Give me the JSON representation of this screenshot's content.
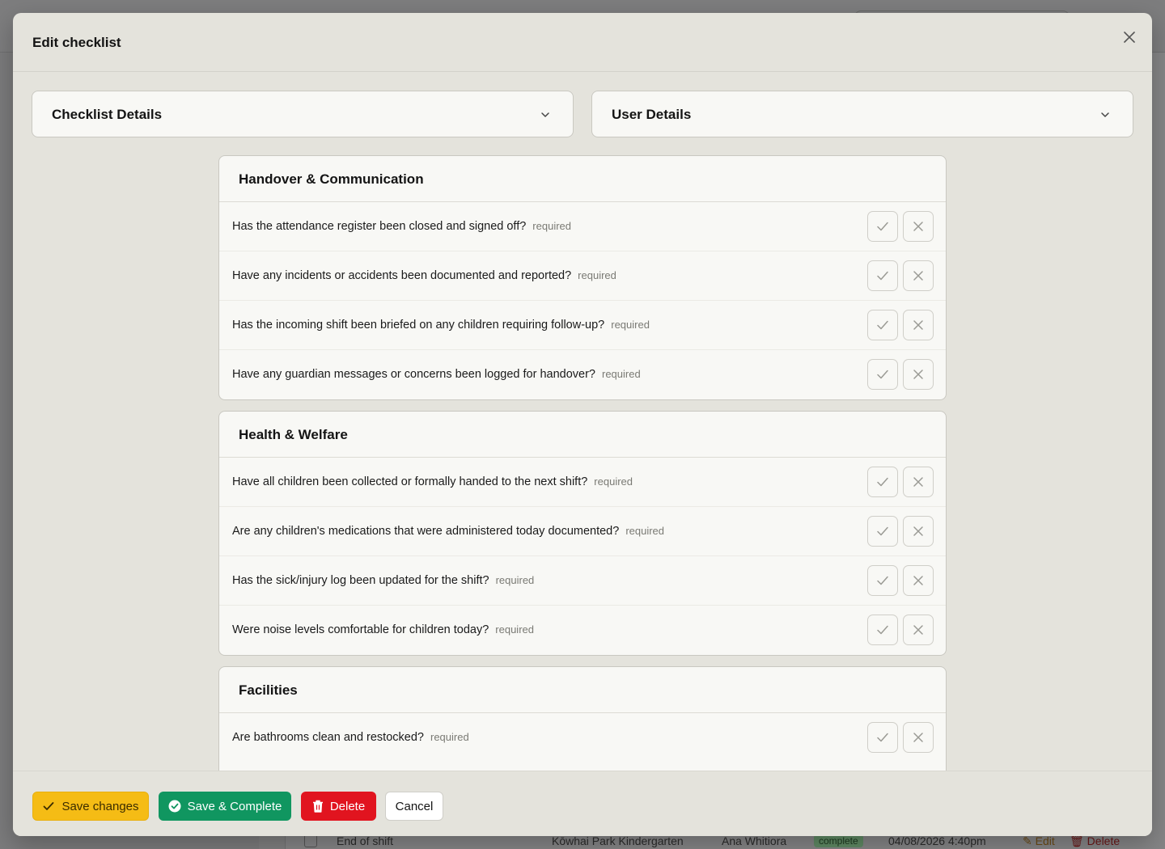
{
  "background": {
    "row": {
      "name": "End of shift",
      "location": "Kōwhai Park Kindergarten",
      "user": "Ana Whitiora",
      "status": "complete",
      "datetime": "04/08/2026 4:40pm",
      "edit_label": "Edit",
      "delete_label": "Delete"
    }
  },
  "modal": {
    "title": "Edit checklist",
    "close_icon": "close-icon",
    "accordions": [
      {
        "title": "Checklist Details"
      },
      {
        "title": "User Details"
      }
    ],
    "required_label": "required",
    "sections": [
      {
        "title": "Handover & Communication",
        "questions": [
          "Has the attendance register been closed and signed off?",
          "Have any incidents or accidents been documented and reported?",
          "Has the incoming shift been briefed on any children requiring follow-up?",
          "Have any guardian messages or concerns been logged for handover?"
        ]
      },
      {
        "title": "Health & Welfare",
        "questions": [
          "Have all children been collected or formally handed to the next shift?",
          "Are any children's medications that were administered today documented?",
          "Has the sick/injury log been updated for the shift?",
          "Were noise levels comfortable for children today?"
        ]
      },
      {
        "title": "Facilities",
        "questions": [
          "Are bathrooms clean and restocked?"
        ]
      }
    ],
    "footer": {
      "save_label": "Save changes",
      "complete_label": "Save & Complete",
      "delete_label": "Delete",
      "cancel_label": "Cancel"
    }
  },
  "colors": {
    "save": "#f5bc15",
    "complete": "#109660",
    "delete": "#e1141f",
    "modal_bg": "#e4e3dc"
  }
}
